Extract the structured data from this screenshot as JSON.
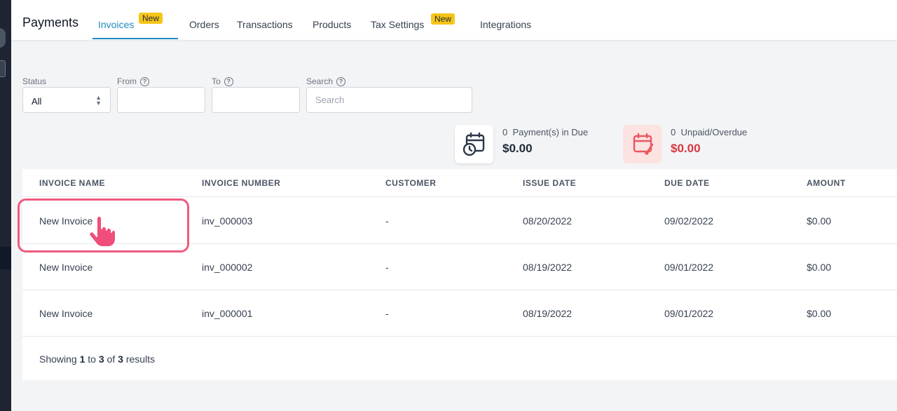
{
  "header": {
    "title": "Payments",
    "tabs": [
      {
        "label": "Invoices",
        "badge": "New",
        "active": true
      },
      {
        "label": "Orders"
      },
      {
        "label": "Transactions"
      },
      {
        "label": "Products"
      },
      {
        "label": "Tax Settings",
        "badge": "New"
      },
      {
        "label": "Integrations"
      }
    ]
  },
  "filters": {
    "status": {
      "label": "Status",
      "value": "All"
    },
    "from": {
      "label": "From",
      "value": ""
    },
    "to": {
      "label": "To",
      "value": ""
    },
    "search": {
      "label": "Search",
      "placeholder": "Search",
      "value": ""
    }
  },
  "stats": {
    "due": {
      "count": "0",
      "label": "Payment(s) in Due",
      "amount": "$0.00"
    },
    "overdue": {
      "count": "0",
      "label": "Unpaid/Overdue",
      "amount": "$0.00"
    }
  },
  "table": {
    "columns": [
      "INVOICE NAME",
      "INVOICE NUMBER",
      "CUSTOMER",
      "ISSUE DATE",
      "DUE DATE",
      "AMOUNT"
    ],
    "rows": [
      {
        "name": "New Invoice",
        "number": "inv_000003",
        "customer": "-",
        "issue_date": "08/20/2022",
        "due_date": "09/02/2022",
        "amount": "$0.00"
      },
      {
        "name": "New Invoice",
        "number": "inv_000002",
        "customer": "-",
        "issue_date": "08/19/2022",
        "due_date": "09/01/2022",
        "amount": "$0.00"
      },
      {
        "name": "New Invoice",
        "number": "inv_000001",
        "customer": "-",
        "issue_date": "08/19/2022",
        "due_date": "09/01/2022",
        "amount": "$0.00"
      }
    ],
    "footer": {
      "prefix": "Showing",
      "from": "1",
      "to_word": "to",
      "to": "3",
      "of_word": "of",
      "total": "3",
      "suffix": "results"
    }
  },
  "colors": {
    "accent": "#1e8bbf",
    "badge": "#f5c518",
    "overdue": "#d9363e",
    "highlight": "#ef5a7f"
  },
  "icons": {
    "due": "calendar-clock-icon",
    "overdue": "calendar-edit-icon",
    "cursor": "pointing-hand-icon"
  }
}
